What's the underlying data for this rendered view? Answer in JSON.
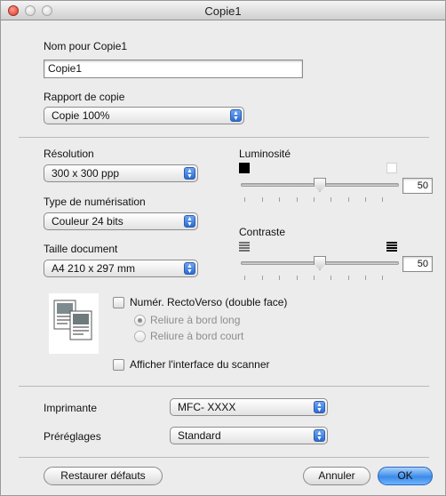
{
  "window": {
    "title": "Copie1"
  },
  "name_section": {
    "label": "Nom pour Copie1",
    "value": "Copie1"
  },
  "copy_ratio": {
    "label": "Rapport de copie",
    "selected": "Copie 100%"
  },
  "resolution": {
    "label": "Résolution",
    "selected": "300 x 300 ppp"
  },
  "scan_type": {
    "label": "Type de numérisation",
    "selected": "Couleur 24 bits"
  },
  "doc_size": {
    "label": "Taille document",
    "selected": "A4  210 x 297 mm"
  },
  "brightness": {
    "label": "Luminosité",
    "value": "50",
    "level": 0.5
  },
  "contrast": {
    "label": "Contraste",
    "value": "50",
    "level": 0.5
  },
  "duplex": {
    "checkbox_label": "Numér. RectoVerso (double face)",
    "checked": false,
    "options": [
      "Reliure à bord long",
      "Reliure à bord court"
    ],
    "selected_option": "Reliure à bord long"
  },
  "scanner_ui": {
    "label": "Afficher l'interface du scanner",
    "checked": false
  },
  "printer": {
    "label": "Imprimante",
    "selected": "MFC- XXXX"
  },
  "presets": {
    "label": "Préréglages",
    "selected": "Standard"
  },
  "buttons": {
    "restore": "Restaurer défauts",
    "cancel": "Annuler",
    "ok": "OK"
  },
  "icons": {
    "close": "close-button-icon",
    "minimize": "minimize-button-icon",
    "zoom": "zoom-button-icon",
    "duplex_doc": "duplex-document-icon",
    "brightness_low": "black-square-icon",
    "brightness_high": "white-square-icon",
    "contrast_low": "low-contrast-lines-icon",
    "contrast_high": "high-contrast-lines-icon",
    "popup_arrows": "up-down-arrows-icon"
  },
  "colors": {
    "accent": "#3b8be8",
    "close_button": "#d63c2c"
  }
}
